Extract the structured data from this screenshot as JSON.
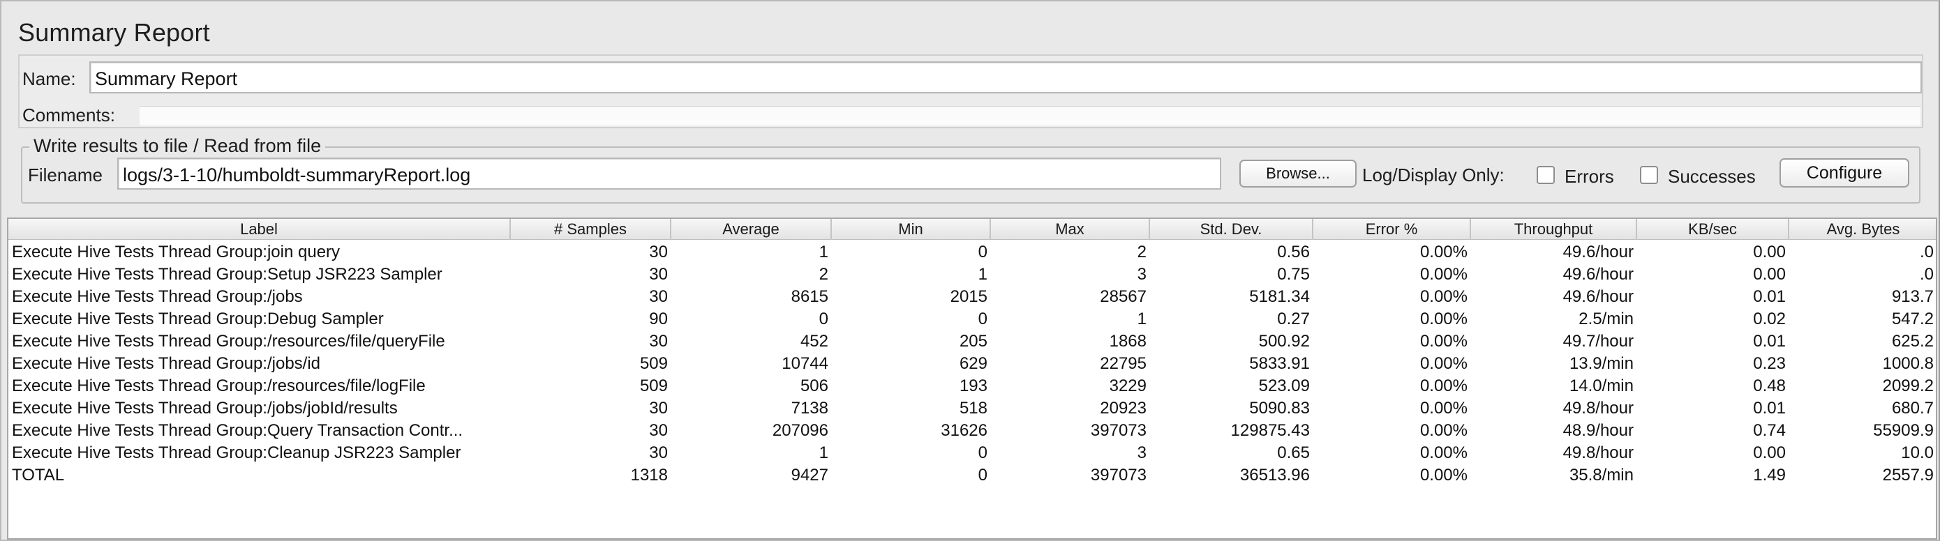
{
  "title": "Summary Report",
  "name_field": {
    "label": "Name:",
    "value": "Summary Report"
  },
  "comments": {
    "label": "Comments:"
  },
  "file_section": {
    "legend": "Write results to file / Read from file",
    "filename_label": "Filename",
    "filename_value": "logs/3-1-10/humboldt-summaryReport.log",
    "browse_label": "Browse...",
    "log_display_label": "Log/Display Only:",
    "errors_label": "Errors",
    "successes_label": "Successes",
    "configure_label": "Configure"
  },
  "table": {
    "headers": [
      "Label",
      "# Samples",
      "Average",
      "Min",
      "Max",
      "Std. Dev.",
      "Error %",
      "Throughput",
      "KB/sec",
      "Avg. Bytes"
    ],
    "rows": [
      [
        "Execute Hive Tests Thread Group:join query",
        "30",
        "1",
        "0",
        "2",
        "0.56",
        "0.00%",
        "49.6/hour",
        "0.00",
        ".0"
      ],
      [
        "Execute Hive Tests Thread Group:Setup JSR223 Sampler",
        "30",
        "2",
        "1",
        "3",
        "0.75",
        "0.00%",
        "49.6/hour",
        "0.00",
        ".0"
      ],
      [
        "Execute Hive Tests Thread Group:/jobs",
        "30",
        "8615",
        "2015",
        "28567",
        "5181.34",
        "0.00%",
        "49.6/hour",
        "0.01",
        "913.7"
      ],
      [
        "Execute Hive Tests Thread Group:Debug Sampler",
        "90",
        "0",
        "0",
        "1",
        "0.27",
        "0.00%",
        "2.5/min",
        "0.02",
        "547.2"
      ],
      [
        "Execute Hive Tests Thread Group:/resources/file/queryFile",
        "30",
        "452",
        "205",
        "1868",
        "500.92",
        "0.00%",
        "49.7/hour",
        "0.01",
        "625.2"
      ],
      [
        "Execute Hive Tests Thread Group:/jobs/id",
        "509",
        "10744",
        "629",
        "22795",
        "5833.91",
        "0.00%",
        "13.9/min",
        "0.23",
        "1000.8"
      ],
      [
        "Execute Hive Tests Thread Group:/resources/file/logFile",
        "509",
        "506",
        "193",
        "3229",
        "523.09",
        "0.00%",
        "14.0/min",
        "0.48",
        "2099.2"
      ],
      [
        "Execute Hive Tests Thread Group:/jobs/jobId/results",
        "30",
        "7138",
        "518",
        "20923",
        "5090.83",
        "0.00%",
        "49.8/hour",
        "0.01",
        "680.7"
      ],
      [
        "Execute Hive Tests Thread Group:Query Transaction Contr...",
        "30",
        "207096",
        "31626",
        "397073",
        "129875.43",
        "0.00%",
        "48.9/hour",
        "0.74",
        "55909.9"
      ],
      [
        "Execute Hive Tests Thread Group:Cleanup JSR223 Sampler",
        "30",
        "1",
        "0",
        "3",
        "0.65",
        "0.00%",
        "49.8/hour",
        "0.00",
        "10.0"
      ],
      [
        "TOTAL",
        "1318",
        "9427",
        "0",
        "397073",
        "36513.96",
        "0.00%",
        "35.8/min",
        "1.49",
        "2557.9"
      ]
    ]
  }
}
